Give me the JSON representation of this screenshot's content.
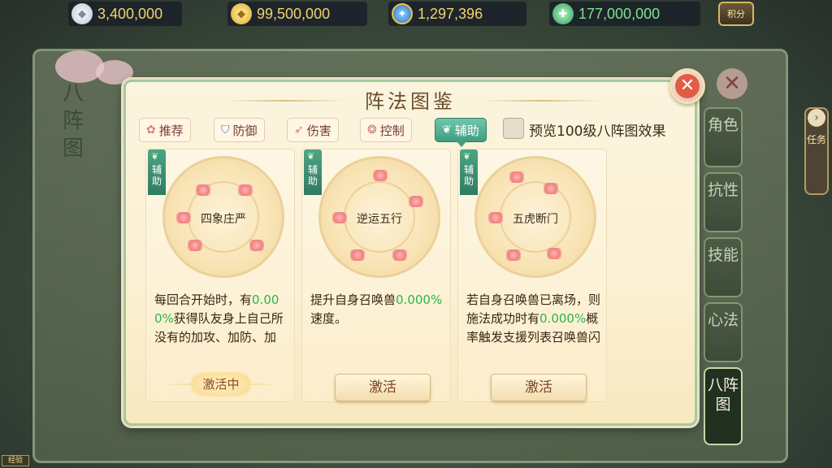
{
  "currencies": [
    {
      "icon": "silver-ingot-icon",
      "value": "3,400,000"
    },
    {
      "icon": "gold-ingot-icon",
      "value": "99,500,000"
    },
    {
      "icon": "blue-coin-icon",
      "value": "1,297,396"
    },
    {
      "icon": "jade-coin-icon",
      "value": "177,000,000"
    }
  ],
  "score_button": "积分",
  "background": {
    "left_title": "八阵图",
    "right_tabs": [
      {
        "label": "角色"
      },
      {
        "label": "抗性"
      },
      {
        "label": "技能"
      },
      {
        "label": "心法"
      },
      {
        "label": "八阵图",
        "active": true
      }
    ],
    "quest_tab": "任务",
    "bottom_tag": "经验"
  },
  "dialog": {
    "title": "阵法图鉴",
    "filters": [
      {
        "label": "推荐",
        "icon": "swirl-icon"
      },
      {
        "label": "防御",
        "icon": "shield-icon"
      },
      {
        "label": "伤害",
        "icon": "feather-icon"
      },
      {
        "label": "控制",
        "icon": "vortex-icon"
      },
      {
        "label": "辅助",
        "icon": "leaf-icon",
        "active": true
      }
    ],
    "preview_label": "预览100级八阵图效果",
    "preview_checked": false,
    "cards": [
      {
        "badge": "辅助",
        "name": "四象庄严",
        "desc_parts": [
          {
            "t": "每回合开始时，有",
            "n": false
          },
          {
            "t": "0.000%",
            "n": true
          },
          {
            "t": "获得队友身上自己所没有的加攻、加防、加速、治愈效果（",
            "n": false
          }
        ],
        "button": "激活中",
        "is_active": true
      },
      {
        "badge": "辅助",
        "name": "逆运五行",
        "desc_parts": [
          {
            "t": "提升自身召唤兽",
            "n": false
          },
          {
            "t": "0.000%",
            "n": true
          },
          {
            "t": "速度。",
            "n": false
          }
        ],
        "button": "激活",
        "is_active": false
      },
      {
        "badge": "辅助",
        "name": "五虎断门",
        "desc_parts": [
          {
            "t": "若自身召唤兽已离场，则施法成功时有",
            "n": false
          },
          {
            "t": "0.000%",
            "n": true
          },
          {
            "t": "概率触发支援列表召唤兽闪现。（仅P",
            "n": false
          }
        ],
        "button": "激活",
        "is_active": false
      }
    ]
  }
}
